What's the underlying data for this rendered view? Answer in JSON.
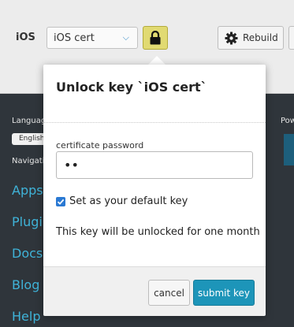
{
  "toolbar": {
    "platform": "iOS",
    "key_select_value": "iOS cert",
    "rebuild_label": "Rebuild"
  },
  "footer": {
    "language_heading": "Language",
    "language_value": "English",
    "navigation_heading": "Navigation",
    "powered_heading": "Pow",
    "nav_links": [
      "Apps",
      "Plugins",
      "Docs",
      "Blog",
      "Help"
    ]
  },
  "modal": {
    "title": "Unlock key `iOS cert`",
    "password_label": "certificate password",
    "password_value": "••",
    "default_key_label": "Set as your default key",
    "default_key_checked": true,
    "note": "This key will be unlocked for one month",
    "cancel_label": "cancel",
    "submit_label": "submit key"
  },
  "colors": {
    "accent": "#1d95b9",
    "lock_button": "#e1da72",
    "link": "#3fb3d8",
    "footer_bg": "#2f353b"
  },
  "icons": {
    "lock": "lock-icon",
    "rebuild": "gear-icon",
    "select": "chevron-down-icon",
    "checkbox": "check-icon"
  }
}
